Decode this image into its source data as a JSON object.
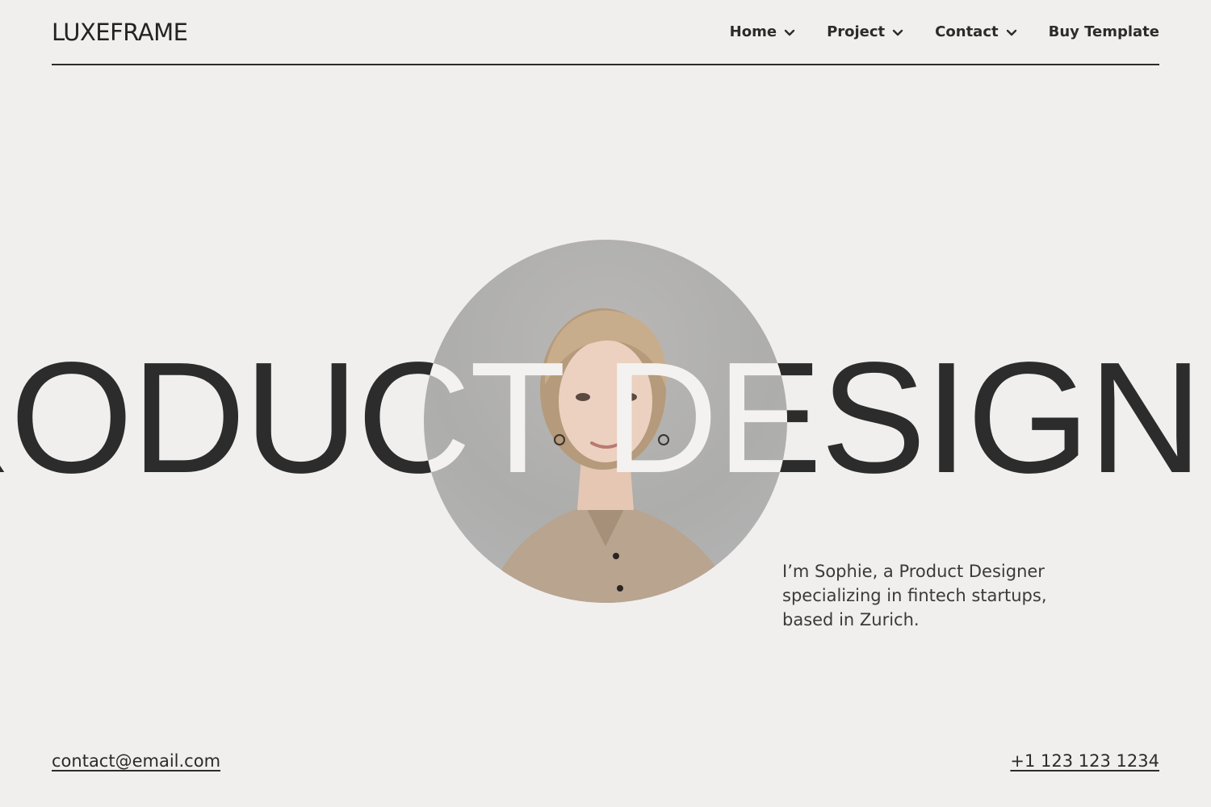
{
  "header": {
    "logo": "LUXEFRAME",
    "nav": [
      {
        "label": "Home",
        "icon": "chevron-down-icon"
      },
      {
        "label": "Project",
        "icon": "chevron-down-icon"
      },
      {
        "label": "Contact",
        "icon": "chevron-down-icon"
      }
    ],
    "buy_label": "Buy Template"
  },
  "hero": {
    "headline": "PRODUCT DESIGNER",
    "portrait": "portrait-photo",
    "intro": "I’m Sophie, a Product Designer specializing in fintech startups, based in Zurich."
  },
  "footer": {
    "email": "contact@email.com",
    "phone": "+1 123 123 1234"
  },
  "colors": {
    "background": "#f0efed",
    "text": "#2b2b2b",
    "headline_over_photo": "#f3f2f0"
  }
}
